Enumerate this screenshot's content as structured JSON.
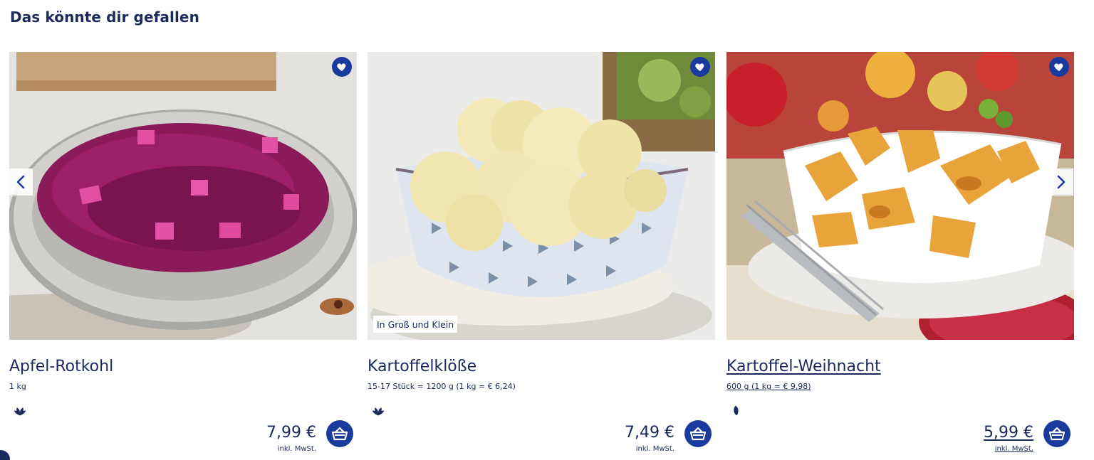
{
  "section": {
    "title": "Das könnte dir gefallen"
  },
  "colors": {
    "primary": "#1a3a9e",
    "text": "#1b2a5c"
  },
  "icons": {
    "favorite": "heart-icon",
    "basket": "basket-icon",
    "leaf": "leaf-icon",
    "prev": "chevron-left-icon",
    "next": "chevron-right-icon"
  },
  "products": [
    {
      "name": "Apfel-Rotkohl",
      "meta": "1 kg",
      "price": "7,99 €",
      "vat": "inkl. MwSt.",
      "tag": ""
    },
    {
      "name": "Kartoffelklöße",
      "meta": "15-17 Stück = 1200 g (1 kg = € 6,24)",
      "price": "7,49 €",
      "vat": "inkl. MwSt.",
      "tag": "In Groß und Klein"
    },
    {
      "name": "Kartoffel-Weihnacht",
      "meta": "600 g (1 kg = € 9,98)",
      "price": "5,99 €",
      "vat": "inkl. MwSt.",
      "tag": ""
    }
  ]
}
